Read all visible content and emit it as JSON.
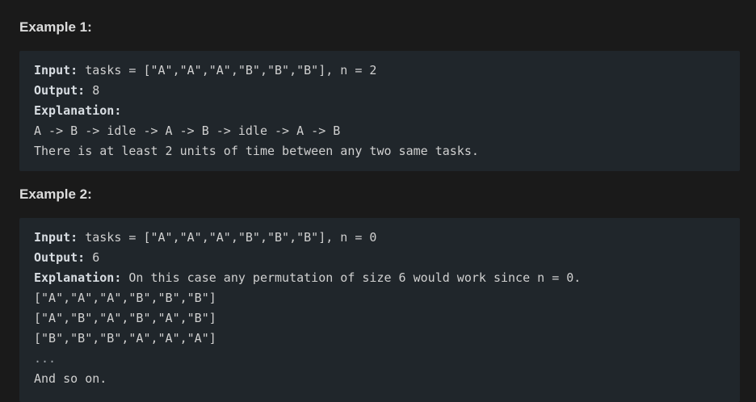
{
  "example1": {
    "heading": "Example 1:",
    "input_label": "Input:",
    "input_value": " tasks = [\"A\",\"A\",\"A\",\"B\",\"B\",\"B\"], n = 2",
    "output_label": "Output:",
    "output_value": " 8",
    "explanation_label": "Explanation:",
    "lines": [
      "A -> B -> idle -> A -> B -> idle -> A -> B",
      "There is at least 2 units of time between any two same tasks."
    ]
  },
  "example2": {
    "heading": "Example 2:",
    "input_label": "Input:",
    "input_value": " tasks = [\"A\",\"A\",\"A\",\"B\",\"B\",\"B\"], n = 0",
    "output_label": "Output:",
    "output_value": " 6",
    "explanation_label": "Explanation:",
    "explanation_value": " On this case any permutation of size 6 would work since n = 0.",
    "lines": [
      "[\"A\",\"A\",\"A\",\"B\",\"B\",\"B\"]",
      "[\"A\",\"B\",\"A\",\"B\",\"A\",\"B\"]",
      "[\"B\",\"B\",\"B\",\"A\",\"A\",\"A\"]",
      "...",
      "And so on."
    ]
  }
}
